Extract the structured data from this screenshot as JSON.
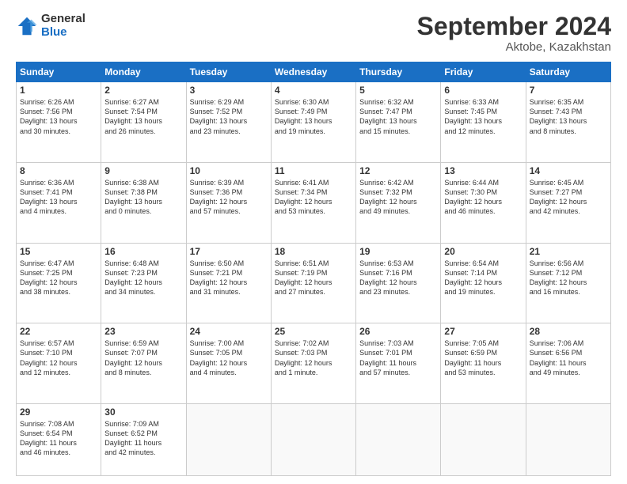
{
  "header": {
    "logo_general": "General",
    "logo_blue": "Blue",
    "month_title": "September 2024",
    "location": "Aktobe, Kazakhstan"
  },
  "days_of_week": [
    "Sunday",
    "Monday",
    "Tuesday",
    "Wednesday",
    "Thursday",
    "Friday",
    "Saturday"
  ],
  "weeks": [
    [
      {
        "day": "1",
        "sunrise": "6:26 AM",
        "sunset": "7:56 PM",
        "daylight": "13 hours and 30 minutes."
      },
      {
        "day": "2",
        "sunrise": "6:27 AM",
        "sunset": "7:54 PM",
        "daylight": "13 hours and 26 minutes."
      },
      {
        "day": "3",
        "sunrise": "6:29 AM",
        "sunset": "7:52 PM",
        "daylight": "13 hours and 23 minutes."
      },
      {
        "day": "4",
        "sunrise": "6:30 AM",
        "sunset": "7:49 PM",
        "daylight": "13 hours and 19 minutes."
      },
      {
        "day": "5",
        "sunrise": "6:32 AM",
        "sunset": "7:47 PM",
        "daylight": "13 hours and 15 minutes."
      },
      {
        "day": "6",
        "sunrise": "6:33 AM",
        "sunset": "7:45 PM",
        "daylight": "13 hours and 12 minutes."
      },
      {
        "day": "7",
        "sunrise": "6:35 AM",
        "sunset": "7:43 PM",
        "daylight": "13 hours and 8 minutes."
      }
    ],
    [
      {
        "day": "8",
        "sunrise": "6:36 AM",
        "sunset": "7:41 PM",
        "daylight": "13 hours and 4 minutes."
      },
      {
        "day": "9",
        "sunrise": "6:38 AM",
        "sunset": "7:38 PM",
        "daylight": "13 hours and 0 minutes."
      },
      {
        "day": "10",
        "sunrise": "6:39 AM",
        "sunset": "7:36 PM",
        "daylight": "12 hours and 57 minutes."
      },
      {
        "day": "11",
        "sunrise": "6:41 AM",
        "sunset": "7:34 PM",
        "daylight": "12 hours and 53 minutes."
      },
      {
        "day": "12",
        "sunrise": "6:42 AM",
        "sunset": "7:32 PM",
        "daylight": "12 hours and 49 minutes."
      },
      {
        "day": "13",
        "sunrise": "6:44 AM",
        "sunset": "7:30 PM",
        "daylight": "12 hours and 46 minutes."
      },
      {
        "day": "14",
        "sunrise": "6:45 AM",
        "sunset": "7:27 PM",
        "daylight": "12 hours and 42 minutes."
      }
    ],
    [
      {
        "day": "15",
        "sunrise": "6:47 AM",
        "sunset": "7:25 PM",
        "daylight": "12 hours and 38 minutes."
      },
      {
        "day": "16",
        "sunrise": "6:48 AM",
        "sunset": "7:23 PM",
        "daylight": "12 hours and 34 minutes."
      },
      {
        "day": "17",
        "sunrise": "6:50 AM",
        "sunset": "7:21 PM",
        "daylight": "12 hours and 31 minutes."
      },
      {
        "day": "18",
        "sunrise": "6:51 AM",
        "sunset": "7:19 PM",
        "daylight": "12 hours and 27 minutes."
      },
      {
        "day": "19",
        "sunrise": "6:53 AM",
        "sunset": "7:16 PM",
        "daylight": "12 hours and 23 minutes."
      },
      {
        "day": "20",
        "sunrise": "6:54 AM",
        "sunset": "7:14 PM",
        "daylight": "12 hours and 19 minutes."
      },
      {
        "day": "21",
        "sunrise": "6:56 AM",
        "sunset": "7:12 PM",
        "daylight": "12 hours and 16 minutes."
      }
    ],
    [
      {
        "day": "22",
        "sunrise": "6:57 AM",
        "sunset": "7:10 PM",
        "daylight": "12 hours and 12 minutes."
      },
      {
        "day": "23",
        "sunrise": "6:59 AM",
        "sunset": "7:07 PM",
        "daylight": "12 hours and 8 minutes."
      },
      {
        "day": "24",
        "sunrise": "7:00 AM",
        "sunset": "7:05 PM",
        "daylight": "12 hours and 4 minutes."
      },
      {
        "day": "25",
        "sunrise": "7:02 AM",
        "sunset": "7:03 PM",
        "daylight": "12 hours and 1 minute."
      },
      {
        "day": "26",
        "sunrise": "7:03 AM",
        "sunset": "7:01 PM",
        "daylight": "11 hours and 57 minutes."
      },
      {
        "day": "27",
        "sunrise": "7:05 AM",
        "sunset": "6:59 PM",
        "daylight": "11 hours and 53 minutes."
      },
      {
        "day": "28",
        "sunrise": "7:06 AM",
        "sunset": "6:56 PM",
        "daylight": "11 hours and 49 minutes."
      }
    ],
    [
      {
        "day": "29",
        "sunrise": "7:08 AM",
        "sunset": "6:54 PM",
        "daylight": "11 hours and 46 minutes."
      },
      {
        "day": "30",
        "sunrise": "7:09 AM",
        "sunset": "6:52 PM",
        "daylight": "11 hours and 42 minutes."
      },
      null,
      null,
      null,
      null,
      null
    ]
  ]
}
